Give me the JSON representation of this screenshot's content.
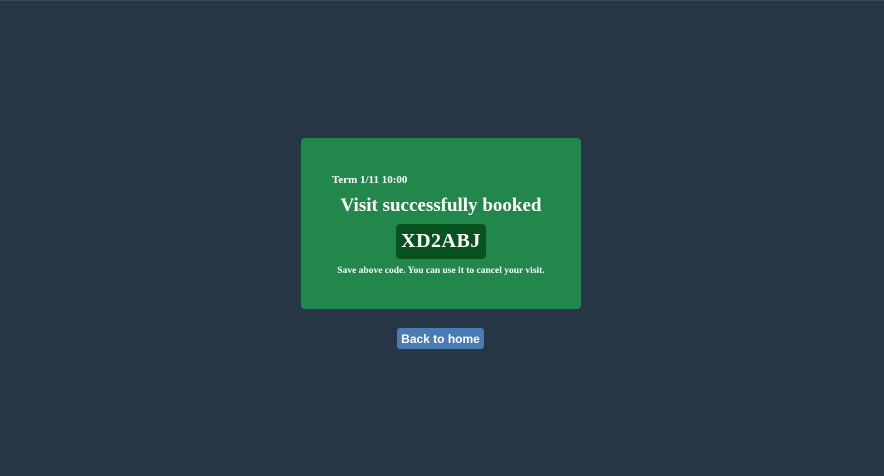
{
  "confirmation": {
    "term": "Term 1/11 10:00",
    "title": "Visit successfully booked",
    "code": "XD2ABJ",
    "note": "Save above code. You can use it to cancel your visit."
  },
  "actions": {
    "back_label": "Back to home"
  },
  "colors": {
    "background": "#263645",
    "card": "#21874b",
    "code_box": "#07521f",
    "button": "#4a7bb3",
    "text": "#ffffff"
  }
}
